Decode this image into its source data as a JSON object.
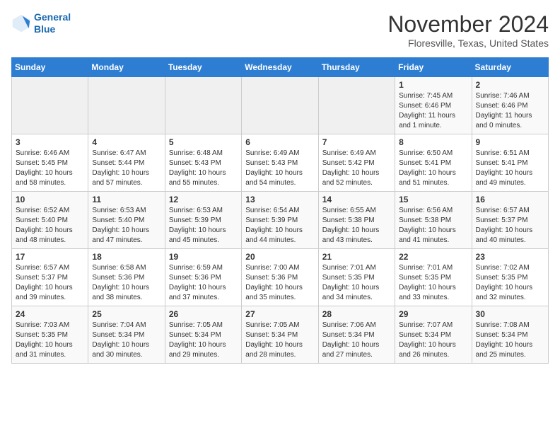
{
  "header": {
    "logo_line1": "General",
    "logo_line2": "Blue",
    "month": "November 2024",
    "location": "Floresville, Texas, United States"
  },
  "weekdays": [
    "Sunday",
    "Monday",
    "Tuesday",
    "Wednesday",
    "Thursday",
    "Friday",
    "Saturday"
  ],
  "weeks": [
    [
      {
        "day": "",
        "content": ""
      },
      {
        "day": "",
        "content": ""
      },
      {
        "day": "",
        "content": ""
      },
      {
        "day": "",
        "content": ""
      },
      {
        "day": "",
        "content": ""
      },
      {
        "day": "1",
        "content": "Sunrise: 7:45 AM\nSunset: 6:46 PM\nDaylight: 11 hours\nand 1 minute."
      },
      {
        "day": "2",
        "content": "Sunrise: 7:46 AM\nSunset: 6:46 PM\nDaylight: 11 hours\nand 0 minutes."
      }
    ],
    [
      {
        "day": "3",
        "content": "Sunrise: 6:46 AM\nSunset: 5:45 PM\nDaylight: 10 hours\nand 58 minutes."
      },
      {
        "day": "4",
        "content": "Sunrise: 6:47 AM\nSunset: 5:44 PM\nDaylight: 10 hours\nand 57 minutes."
      },
      {
        "day": "5",
        "content": "Sunrise: 6:48 AM\nSunset: 5:43 PM\nDaylight: 10 hours\nand 55 minutes."
      },
      {
        "day": "6",
        "content": "Sunrise: 6:49 AM\nSunset: 5:43 PM\nDaylight: 10 hours\nand 54 minutes."
      },
      {
        "day": "7",
        "content": "Sunrise: 6:49 AM\nSunset: 5:42 PM\nDaylight: 10 hours\nand 52 minutes."
      },
      {
        "day": "8",
        "content": "Sunrise: 6:50 AM\nSunset: 5:41 PM\nDaylight: 10 hours\nand 51 minutes."
      },
      {
        "day": "9",
        "content": "Sunrise: 6:51 AM\nSunset: 5:41 PM\nDaylight: 10 hours\nand 49 minutes."
      }
    ],
    [
      {
        "day": "10",
        "content": "Sunrise: 6:52 AM\nSunset: 5:40 PM\nDaylight: 10 hours\nand 48 minutes."
      },
      {
        "day": "11",
        "content": "Sunrise: 6:53 AM\nSunset: 5:40 PM\nDaylight: 10 hours\nand 47 minutes."
      },
      {
        "day": "12",
        "content": "Sunrise: 6:53 AM\nSunset: 5:39 PM\nDaylight: 10 hours\nand 45 minutes."
      },
      {
        "day": "13",
        "content": "Sunrise: 6:54 AM\nSunset: 5:39 PM\nDaylight: 10 hours\nand 44 minutes."
      },
      {
        "day": "14",
        "content": "Sunrise: 6:55 AM\nSunset: 5:38 PM\nDaylight: 10 hours\nand 43 minutes."
      },
      {
        "day": "15",
        "content": "Sunrise: 6:56 AM\nSunset: 5:38 PM\nDaylight: 10 hours\nand 41 minutes."
      },
      {
        "day": "16",
        "content": "Sunrise: 6:57 AM\nSunset: 5:37 PM\nDaylight: 10 hours\nand 40 minutes."
      }
    ],
    [
      {
        "day": "17",
        "content": "Sunrise: 6:57 AM\nSunset: 5:37 PM\nDaylight: 10 hours\nand 39 minutes."
      },
      {
        "day": "18",
        "content": "Sunrise: 6:58 AM\nSunset: 5:36 PM\nDaylight: 10 hours\nand 38 minutes."
      },
      {
        "day": "19",
        "content": "Sunrise: 6:59 AM\nSunset: 5:36 PM\nDaylight: 10 hours\nand 37 minutes."
      },
      {
        "day": "20",
        "content": "Sunrise: 7:00 AM\nSunset: 5:36 PM\nDaylight: 10 hours\nand 35 minutes."
      },
      {
        "day": "21",
        "content": "Sunrise: 7:01 AM\nSunset: 5:35 PM\nDaylight: 10 hours\nand 34 minutes."
      },
      {
        "day": "22",
        "content": "Sunrise: 7:01 AM\nSunset: 5:35 PM\nDaylight: 10 hours\nand 33 minutes."
      },
      {
        "day": "23",
        "content": "Sunrise: 7:02 AM\nSunset: 5:35 PM\nDaylight: 10 hours\nand 32 minutes."
      }
    ],
    [
      {
        "day": "24",
        "content": "Sunrise: 7:03 AM\nSunset: 5:35 PM\nDaylight: 10 hours\nand 31 minutes."
      },
      {
        "day": "25",
        "content": "Sunrise: 7:04 AM\nSunset: 5:34 PM\nDaylight: 10 hours\nand 30 minutes."
      },
      {
        "day": "26",
        "content": "Sunrise: 7:05 AM\nSunset: 5:34 PM\nDaylight: 10 hours\nand 29 minutes."
      },
      {
        "day": "27",
        "content": "Sunrise: 7:05 AM\nSunset: 5:34 PM\nDaylight: 10 hours\nand 28 minutes."
      },
      {
        "day": "28",
        "content": "Sunrise: 7:06 AM\nSunset: 5:34 PM\nDaylight: 10 hours\nand 27 minutes."
      },
      {
        "day": "29",
        "content": "Sunrise: 7:07 AM\nSunset: 5:34 PM\nDaylight: 10 hours\nand 26 minutes."
      },
      {
        "day": "30",
        "content": "Sunrise: 7:08 AM\nSunset: 5:34 PM\nDaylight: 10 hours\nand 25 minutes."
      }
    ]
  ]
}
